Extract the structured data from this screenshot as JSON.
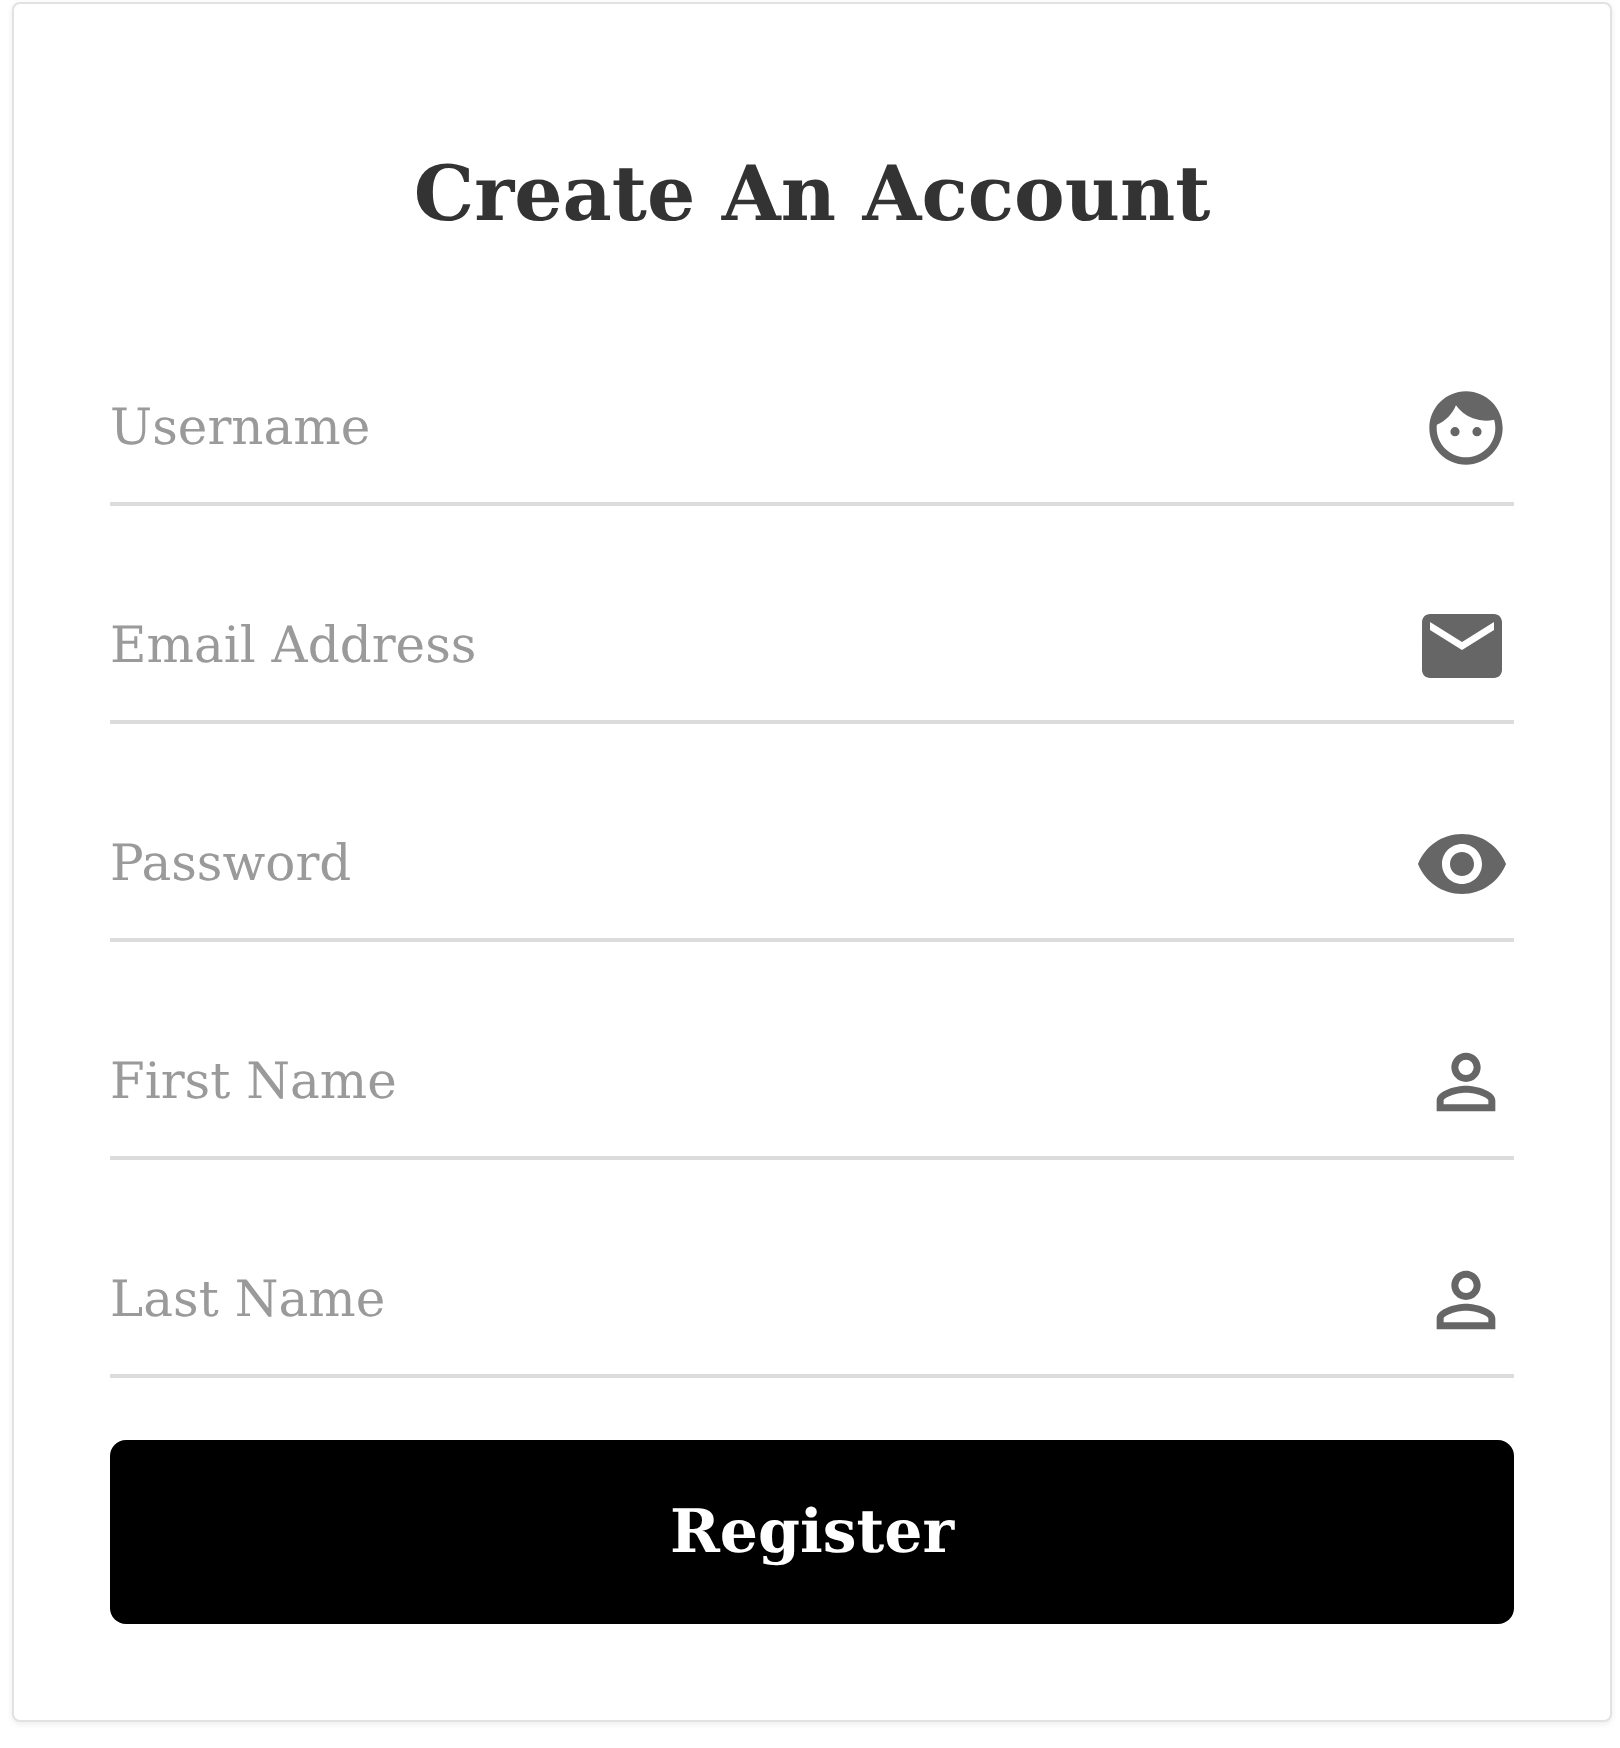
{
  "title": "Create An Account",
  "fields": [
    {
      "placeholder": "Username",
      "kind": "face"
    },
    {
      "placeholder": "Email Address",
      "kind": "mail"
    },
    {
      "placeholder": "Password",
      "kind": "eye"
    },
    {
      "placeholder": "First Name",
      "kind": "person"
    },
    {
      "placeholder": "Last Name",
      "kind": "person"
    }
  ],
  "button": "Register"
}
